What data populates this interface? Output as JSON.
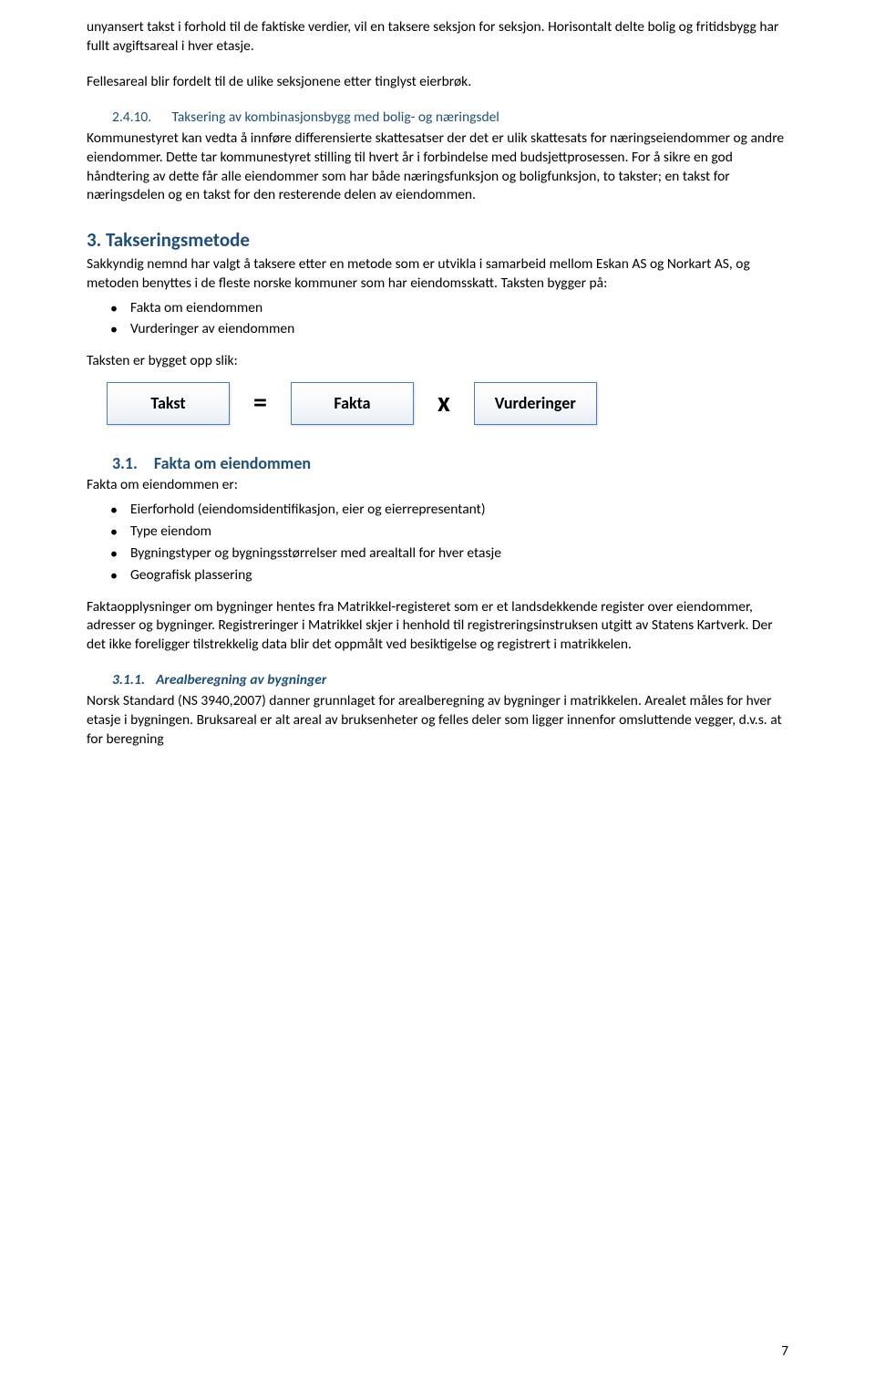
{
  "intro": {
    "p1a": "unyansert takst i forhold til de faktiske verdier, vil en taksere seksjon for seksjon. Horisontalt delte bolig og fritidsbygg har fullt avgiftsareal i hver etasje.",
    "p1b": "Fellesareal blir fordelt til de ulike seksjonene etter tinglyst eierbrøk."
  },
  "sec2410": {
    "num": "2.4.10.",
    "title": "Taksering av kombinasjonsbygg med bolig- og næringsdel",
    "body": "Kommunestyret kan vedta å innføre differensierte skattesatser der det er ulik skattesats for næringseiendommer og andre eiendommer. Dette tar kommunestyret stilling til hvert år i forbindelse med budsjettprosessen. For å sikre en god håndtering av dette får alle eiendommer som har både næringsfunksjon og boligfunksjon, to takster; en takst for næringsdelen og en takst for den resterende delen av eiendommen."
  },
  "sec3": {
    "heading": "3. Takseringsmetode",
    "intro": "Sakkyndig nemnd har valgt å taksere etter en metode som er utvikla i samarbeid mellom Eskan AS og Norkart AS, og metoden benyttes i de fleste norske kommuner som har eiendomsskatt. Taksten bygger på:",
    "bullets": [
      "Fakta om eiendommen",
      "Vurderinger av eiendommen"
    ],
    "formula_intro": "Taksten er bygget opp slik:",
    "formula": {
      "box1": "Takst",
      "op1": "=",
      "box2": "Fakta",
      "op2": "x",
      "box3": "Vurderinger"
    }
  },
  "sec31": {
    "num": "3.1.",
    "title": "Fakta om eiendommen",
    "intro": "Fakta om eiendommen er:",
    "bullets": [
      "Eierforhold (eiendomsidentifikasjon, eier og eierrepresentant)",
      "Type eiendom",
      "Bygningstyper og bygningsstørrelser med arealtall for hver etasje",
      "Geografisk plassering"
    ],
    "body": "Faktaopplysninger om bygninger hentes fra Matrikkel-registeret som er et landsdekkende register over eiendommer, adresser og bygninger. Registreringer i Matrikkel skjer i henhold til registreringsinstruksen utgitt av Statens Kartverk. Der det ikke foreligger tilstrekkelig data blir det oppmålt ved besiktigelse og registrert i matrikkelen."
  },
  "sec311": {
    "num": "3.1.1.",
    "title": "Arealberegning av bygninger",
    "body": "Norsk Standard (NS 3940,2007) danner grunnlaget for arealberegning av bygninger i matrikkelen. Arealet måles for hver etasje i bygningen. Bruksareal er alt areal av bruksenheter og felles deler som ligger innenfor omsluttende vegger, d.v.s. at for beregning"
  },
  "pageNumber": "7"
}
